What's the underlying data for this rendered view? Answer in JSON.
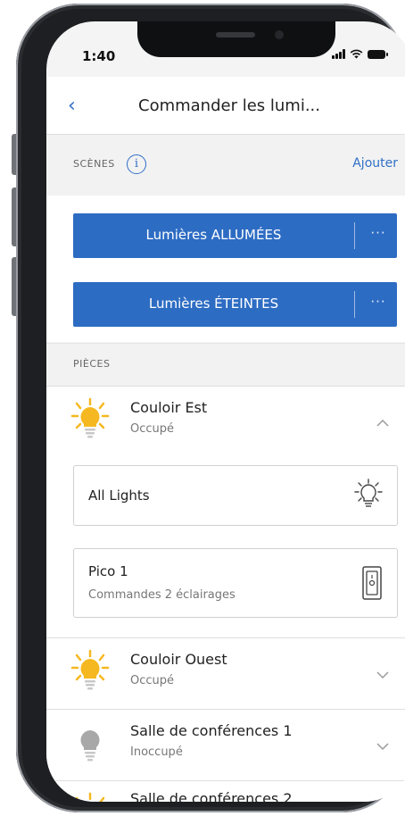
{
  "status_bar": {
    "time": "1:40"
  },
  "nav": {
    "title": "Commander les lumi..."
  },
  "scenes": {
    "header": "SCÈNES",
    "add_label": "Ajouter",
    "buttons": [
      {
        "label": "Lumières ALLUMÉES",
        "more": "···"
      },
      {
        "label": "Lumières ÉTEINTES",
        "more": "···"
      }
    ]
  },
  "rooms": {
    "header": "PIÈCES",
    "items": [
      {
        "name": "Couloir Est",
        "status": "Occupé",
        "occupied": true,
        "expanded": true
      },
      {
        "name": "Couloir Ouest",
        "status": "Occupé",
        "occupied": true,
        "expanded": false
      },
      {
        "name": "Salle de conférences 1",
        "status": "Inoccupé",
        "occupied": false,
        "expanded": false
      },
      {
        "name": "Salle de conférences 2",
        "status": "",
        "occupied": true,
        "expanded": false
      }
    ],
    "devices": [
      {
        "name": "All Lights",
        "icon": "light-bulb-outline-icon"
      },
      {
        "name": "Pico 1",
        "subtitle": "Commandes 2 éclairages",
        "icon": "pico-remote-icon"
      }
    ]
  },
  "colors": {
    "accent": "#2f6fc6",
    "scene_button": "#2d6cc3",
    "bulb_on": "#f5b820",
    "bulb_off": "#a8a8a8"
  }
}
